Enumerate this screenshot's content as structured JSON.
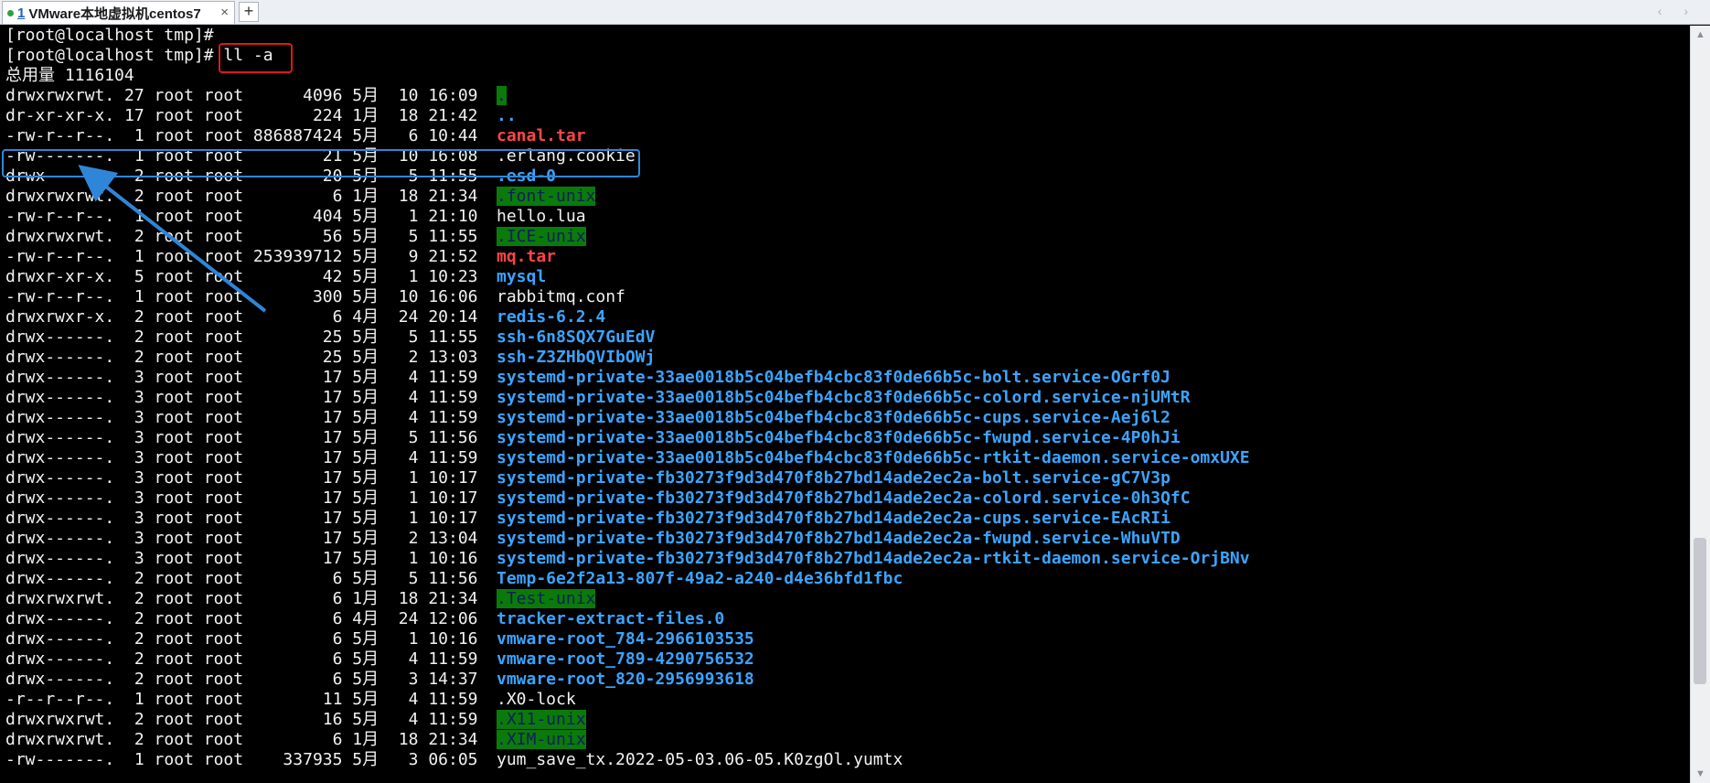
{
  "tab": {
    "index": "1",
    "title": "VMware本地虚拟机centos7",
    "close": "×"
  },
  "new_tab": "+",
  "tab_nav": "‹ ›",
  "terminal": {
    "prompts": [
      "[root@localhost tmp]#",
      "[root@localhost tmp]# ll -a"
    ],
    "total": "总用量 1116104",
    "entries": [
      {
        "meta": "drwxrwxrwt. 27 root root      4096 5月  10 16:09",
        "name": ".",
        "style": "sticky"
      },
      {
        "meta": "dr-xr-xr-x. 17 root root       224 1月  18 21:42",
        "name": "..",
        "style": "dir"
      },
      {
        "meta": "-rw-r--r--.  1 root root 886887424 5月   6 10:44",
        "name": "canal.tar",
        "style": "tar"
      },
      {
        "meta": "-rw-------.  1 root root        21 5月  10 16:08",
        "name": ".erlang.cookie",
        "style": "plain"
      },
      {
        "meta": "drwx------.  2 root root        20 5月   5 11:55",
        "name": ".esd-0",
        "style": "dir"
      },
      {
        "meta": "drwxrwxrwt.  2 root root         6 1月  18 21:34",
        "name": ".font-unix",
        "style": "sticky"
      },
      {
        "meta": "-rw-r--r--.  1 root root       404 5月   1 21:10",
        "name": "hello.lua",
        "style": "plain"
      },
      {
        "meta": "drwxrwxrwt.  2 root root        56 5月   5 11:55",
        "name": ".ICE-unix",
        "style": "sticky"
      },
      {
        "meta": "-rw-r--r--.  1 root root 253939712 5月   9 21:52",
        "name": "mq.tar",
        "style": "tar"
      },
      {
        "meta": "drwxr-xr-x.  5 root root        42 5月   1 10:23",
        "name": "mysql",
        "style": "dir"
      },
      {
        "meta": "-rw-r--r--.  1 root root       300 5月  10 16:06",
        "name": "rabbitmq.conf",
        "style": "plain"
      },
      {
        "meta": "drwxrwxr-x.  2 root root         6 4月  24 20:14",
        "name": "redis-6.2.4",
        "style": "dir"
      },
      {
        "meta": "drwx------.  2 root root        25 5月   5 11:55",
        "name": "ssh-6n8SQX7GuEdV",
        "style": "dir"
      },
      {
        "meta": "drwx------.  2 root root        25 5月   2 13:03",
        "name": "ssh-Z3ZHbQVIbOWj",
        "style": "dir"
      },
      {
        "meta": "drwx------.  3 root root        17 5月   4 11:59",
        "name": "systemd-private-33ae0018b5c04befb4cbc83f0de66b5c-bolt.service-OGrf0J",
        "style": "dir"
      },
      {
        "meta": "drwx------.  3 root root        17 5月   4 11:59",
        "name": "systemd-private-33ae0018b5c04befb4cbc83f0de66b5c-colord.service-njUMtR",
        "style": "dir"
      },
      {
        "meta": "drwx------.  3 root root        17 5月   4 11:59",
        "name": "systemd-private-33ae0018b5c04befb4cbc83f0de66b5c-cups.service-Aej6l2",
        "style": "dir"
      },
      {
        "meta": "drwx------.  3 root root        17 5月   5 11:56",
        "name": "systemd-private-33ae0018b5c04befb4cbc83f0de66b5c-fwupd.service-4P0hJi",
        "style": "dir"
      },
      {
        "meta": "drwx------.  3 root root        17 5月   4 11:59",
        "name": "systemd-private-33ae0018b5c04befb4cbc83f0de66b5c-rtkit-daemon.service-omxUXE",
        "style": "dir"
      },
      {
        "meta": "drwx------.  3 root root        17 5月   1 10:17",
        "name": "systemd-private-fb30273f9d3d470f8b27bd14ade2ec2a-bolt.service-gC7V3p",
        "style": "dir"
      },
      {
        "meta": "drwx------.  3 root root        17 5月   1 10:17",
        "name": "systemd-private-fb30273f9d3d470f8b27bd14ade2ec2a-colord.service-0h3QfC",
        "style": "dir"
      },
      {
        "meta": "drwx------.  3 root root        17 5月   1 10:17",
        "name": "systemd-private-fb30273f9d3d470f8b27bd14ade2ec2a-cups.service-EAcRIi",
        "style": "dir"
      },
      {
        "meta": "drwx------.  3 root root        17 5月   2 13:04",
        "name": "systemd-private-fb30273f9d3d470f8b27bd14ade2ec2a-fwupd.service-WhuVTD",
        "style": "dir"
      },
      {
        "meta": "drwx------.  3 root root        17 5月   1 10:16",
        "name": "systemd-private-fb30273f9d3d470f8b27bd14ade2ec2a-rtkit-daemon.service-OrjBNv",
        "style": "dir"
      },
      {
        "meta": "drwx------.  2 root root         6 5月   5 11:56",
        "name": "Temp-6e2f2a13-807f-49a2-a240-d4e36bfd1fbc",
        "style": "dir"
      },
      {
        "meta": "drwxrwxrwt.  2 root root         6 1月  18 21:34",
        "name": ".Test-unix",
        "style": "sticky"
      },
      {
        "meta": "drwx------.  2 root root         6 4月  24 12:06",
        "name": "tracker-extract-files.0",
        "style": "dir"
      },
      {
        "meta": "drwx------.  2 root root         6 5月   1 10:16",
        "name": "vmware-root_784-2966103535",
        "style": "dir"
      },
      {
        "meta": "drwx------.  2 root root         6 5月   4 11:59",
        "name": "vmware-root_789-4290756532",
        "style": "dir"
      },
      {
        "meta": "drwx------.  2 root root         6 5月   3 14:37",
        "name": "vmware-root_820-2956993618",
        "style": "dir"
      },
      {
        "meta": "-r--r--r--.  1 root root        11 5月   4 11:59",
        "name": ".X0-lock",
        "style": "plain"
      },
      {
        "meta": "drwxrwxrwt.  2 root root        16 5月   4 11:59",
        "name": ".X11-unix",
        "style": "sticky"
      },
      {
        "meta": "drwxrwxrwt.  2 root root         6 1月  18 21:34",
        "name": ".XIM-unix",
        "style": "sticky"
      },
      {
        "meta": "-rw-------.  1 root root    337935 5月   3 06:05",
        "name": "yum_save_tx.2022-05-03.06-05.K0zgOl.yumtx",
        "style": "plain"
      }
    ]
  },
  "scrollbar": {
    "up": "▲",
    "down": "▼",
    "position": 0.86
  },
  "annotation_colors": {
    "highlight_box": "#e01818",
    "selection_box": "#2f86d8",
    "arrow": "#2f86d8"
  }
}
